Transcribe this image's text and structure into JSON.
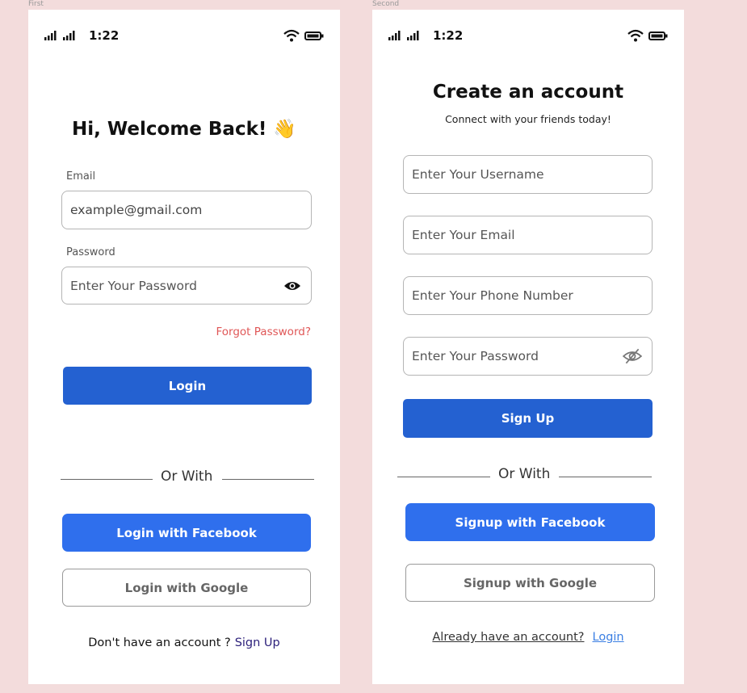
{
  "screen1": {
    "frame_label": "First",
    "status": {
      "time": "1:22"
    },
    "title": "Hi, Welcome Back!",
    "wave_emoji": "👋",
    "email_label": "Email",
    "email_value": "example@gmail.com",
    "password_label": "Password",
    "password_placeholder": "Enter Your Password",
    "forgot": "Forgot Password?",
    "login_button": "Login",
    "divider": "Or With",
    "facebook_button": "Login with Facebook",
    "google_button": "Login with Google",
    "footer_text": "Don't have an account ?",
    "footer_link": "Sign Up"
  },
  "screen2": {
    "frame_label": "Second",
    "status": {
      "time": "1:22"
    },
    "title": "Create an account",
    "subtitle": "Connect with your friends today!",
    "username_placeholder": "Enter Your Username",
    "email_placeholder": "Enter Your Email",
    "phone_placeholder": "Enter Your Phone Number",
    "password_placeholder": "Enter Your Password",
    "signup_button": "Sign Up",
    "divider": "Or With",
    "facebook_button": "Signup with Facebook",
    "google_button": "Signup with Google",
    "footer_text": "Already have an account?",
    "footer_link": "Login"
  },
  "colors": {
    "background": "#f3dcdc",
    "primary": "#2461d1",
    "facebook": "#2f6fed",
    "forgot": "#e05757",
    "link": "#3b7fe3"
  }
}
